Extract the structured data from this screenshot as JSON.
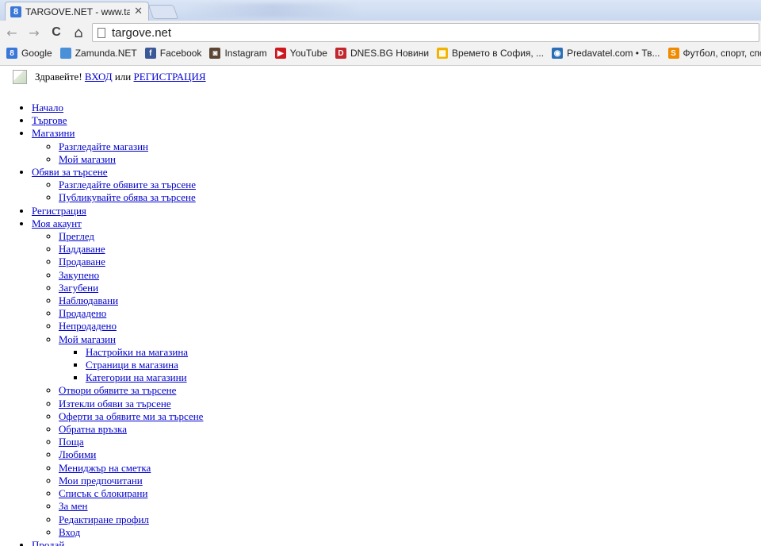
{
  "browser": {
    "tab_title": "TARGOVE.NET - www.targ",
    "tab_favicon_letter": "8",
    "url": "targove.net",
    "nav": {
      "back": "←",
      "forward": "→",
      "reload": "C",
      "home": "⌂"
    },
    "bookmarks": [
      {
        "label": "Google",
        "icon": "google-icon",
        "color": "#3b77d8",
        "glyph": "8"
      },
      {
        "label": "Zamunda.NET",
        "icon": "zamunda-icon",
        "color": "#4a90d9",
        "glyph": ""
      },
      {
        "label": "Facebook",
        "icon": "facebook-icon",
        "color": "#3b5998",
        "glyph": "f"
      },
      {
        "label": "Instagram",
        "icon": "instagram-icon",
        "color": "#5b4636",
        "glyph": "◙"
      },
      {
        "label": "YouTube",
        "icon": "youtube-icon",
        "color": "#cc181e",
        "glyph": "▶"
      },
      {
        "label": "DNES.BG Новини",
        "icon": "dnes-icon",
        "color": "#c1272d",
        "glyph": "D"
      },
      {
        "label": "Времето в София, ...",
        "icon": "weather-icon",
        "color": "#f0b400",
        "glyph": "▦"
      },
      {
        "label": "Predavatel.com • Тв...",
        "icon": "predavatel-icon",
        "color": "#2a6fb5",
        "glyph": "◉"
      },
      {
        "label": "Футбол, спорт, спо...",
        "icon": "sport-icon",
        "color": "#f08a00",
        "glyph": "S"
      }
    ]
  },
  "page": {
    "greeting": "Здравейте!",
    "login": "ВХОД",
    "or": "или",
    "register": "РЕГИСТРАЦИЯ",
    "menu": [
      {
        "label": "Начало"
      },
      {
        "label": "Търгове"
      },
      {
        "label": "Магазини",
        "children": [
          {
            "label": "Разгледайте магазин"
          },
          {
            "label": "Мой магазин"
          }
        ]
      },
      {
        "label": "Обяви за търсене",
        "children": [
          {
            "label": "Разгледайте обявите за търсене"
          },
          {
            "label": "Публикувайте обява за търсене"
          }
        ]
      },
      {
        "label": "Регистрация"
      },
      {
        "label": "Моя акаунт",
        "children": [
          {
            "label": "Преглед"
          },
          {
            "label": "Наддаване"
          },
          {
            "label": "Продаване"
          },
          {
            "label": "Закупено"
          },
          {
            "label": "Загубени"
          },
          {
            "label": "Наблюдавани"
          },
          {
            "label": "Продадено"
          },
          {
            "label": "Непродадено"
          },
          {
            "label": "Мой магазин",
            "children": [
              {
                "label": "Настройки на магазина"
              },
              {
                "label": "Страници в магазина"
              },
              {
                "label": "Категории на магазини"
              }
            ]
          },
          {
            "label": "Отвори обявите за търсене"
          },
          {
            "label": "Изтекли обяви за търсене"
          },
          {
            "label": "Оферти за обявите ми за търсене"
          },
          {
            "label": "Обратна връзка"
          },
          {
            "label": "Поща"
          },
          {
            "label": "Любими"
          },
          {
            "label": "Мениджър на сметка"
          },
          {
            "label": "Мои предпочитани"
          },
          {
            "label": "Списък с блокирани"
          },
          {
            "label": "За мен"
          },
          {
            "label": "Редактиране профил"
          },
          {
            "label": "Вход"
          }
        ]
      },
      {
        "label": "Продай"
      }
    ]
  }
}
